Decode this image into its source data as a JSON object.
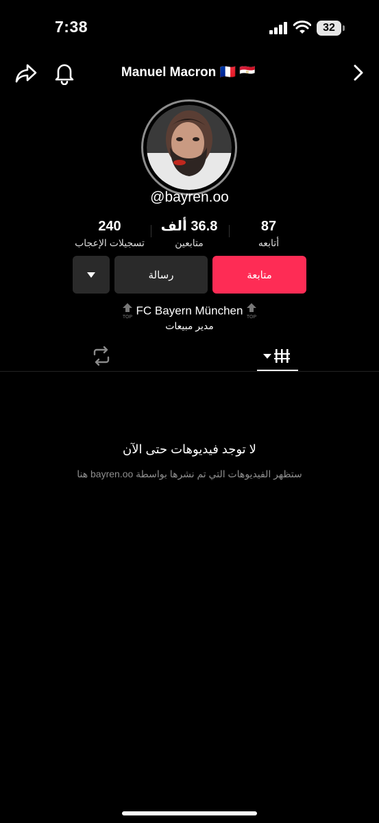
{
  "status_bar": {
    "time": "7:38",
    "battery": "32",
    "icons": [
      "signal-icon",
      "wifi-icon",
      "battery-icon"
    ]
  },
  "nav": {
    "title": "Manuel Macron 🇫🇷 🇪🇬",
    "icons": [
      "share-icon",
      "bell-icon",
      "chevron-right-icon"
    ]
  },
  "profile": {
    "username": "@bayren.oo",
    "stats": {
      "likes": {
        "value": "240",
        "label": "تسجيلات الإعجاب"
      },
      "followers": {
        "value": "36.8 ألف",
        "label": "متابعين"
      },
      "following": {
        "value": "87",
        "label": "أتابعه"
      }
    },
    "buttons": {
      "follow": "متابعة",
      "message": "رسالة"
    },
    "bio": {
      "line1": "FC Bayern München",
      "badge": "TOP",
      "line2": "مدير مبيعات"
    }
  },
  "tabs": {
    "icons": [
      "repost-icon",
      "videos-grid-icon"
    ]
  },
  "empty_state": {
    "title": "لا توجد فيديوهات حتى الآن",
    "subtitle": "ستظهر الفيديوهات التي تم نشرها بواسطة bayren.oo هنا"
  },
  "colors": {
    "background": "#000000",
    "accent": "#fe2c55",
    "button_dark": "#2a2a2a",
    "muted_text": "#8e8e8e"
  }
}
